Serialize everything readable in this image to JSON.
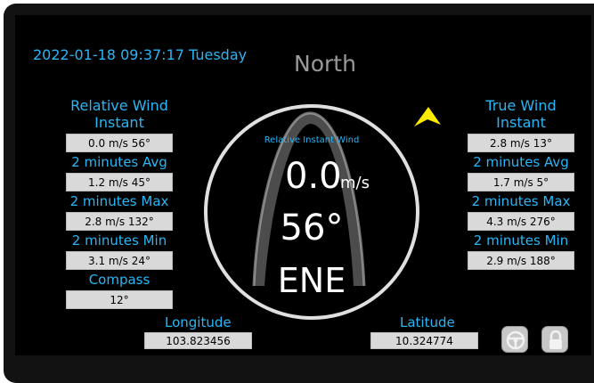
{
  "header": {
    "datetime": "2022-01-18 09:37:17 Tuesday",
    "heading": "North"
  },
  "relative_wind": {
    "title_line1": "Relative Wind",
    "title_line2": "Instant",
    "instant": "0.0 m/s 56°",
    "avg_label": "2 minutes Avg",
    "avg": "1.2 m/s 45°",
    "max_label": "2 minutes Max",
    "max": "2.8 m/s 132°",
    "min_label": "2 minutes Min",
    "min": "3.1 m/s 24°",
    "compass_label": "Compass",
    "compass": "12°"
  },
  "true_wind": {
    "title_line1": "True Wind",
    "title_line2": "Instant",
    "instant": "2.8 m/s 13°",
    "avg_label": "2 minutes Avg",
    "avg": "1.7 m/s 5°",
    "max_label": "2 minutes Max",
    "max": "4.3 m/s 276°",
    "min_label": "2 minutes Min",
    "min": "2.9 m/s 188°"
  },
  "dial": {
    "caption": "Relative Instant Wind",
    "speed": "0.0",
    "speed_unit": "m/s",
    "direction": "56°",
    "cardinal": "ENE"
  },
  "position": {
    "longitude_label": "Longitude",
    "longitude": "103.823456",
    "latitude_label": "Latitude",
    "latitude": "10.324774"
  },
  "controls": {
    "settings_icon": "steering-wheel-icon",
    "lock_icon": "lock-icon"
  },
  "colors": {
    "accent": "#29b6f6",
    "pointer": "#ffeb00",
    "value_box": "#d9d9d9"
  }
}
